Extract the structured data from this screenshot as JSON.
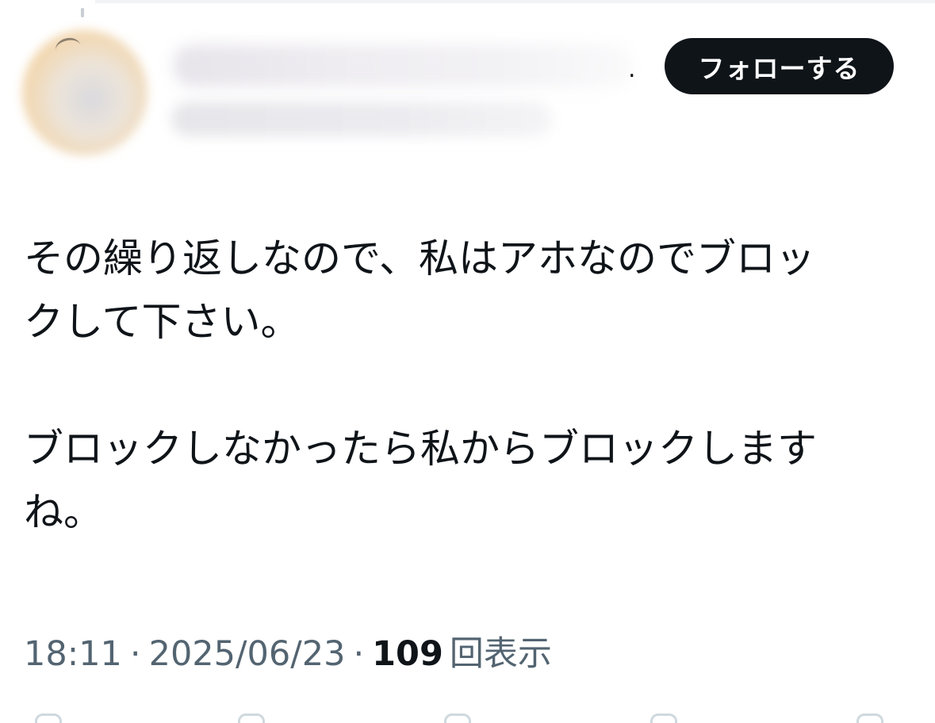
{
  "post": {
    "author": {
      "display_name_suffix": "."
    },
    "follow_button_label": "フォローする",
    "text_lines": [
      "その繰り返しなので、私はアホなのでブロッ",
      "クして下さい。",
      "",
      "ブロックしなかったら私からブロックします",
      "ね。"
    ],
    "timestamp_time": "18:11",
    "separator": "·",
    "timestamp_date": "2025/06/23",
    "views_count": "109",
    "views_label": "回表示"
  },
  "icons": {
    "avatar": "avatar-image-blurred",
    "action_bar": [
      "reply-icon",
      "retweet-icon",
      "like-icon",
      "bookmark-icon",
      "share-icon"
    ]
  }
}
